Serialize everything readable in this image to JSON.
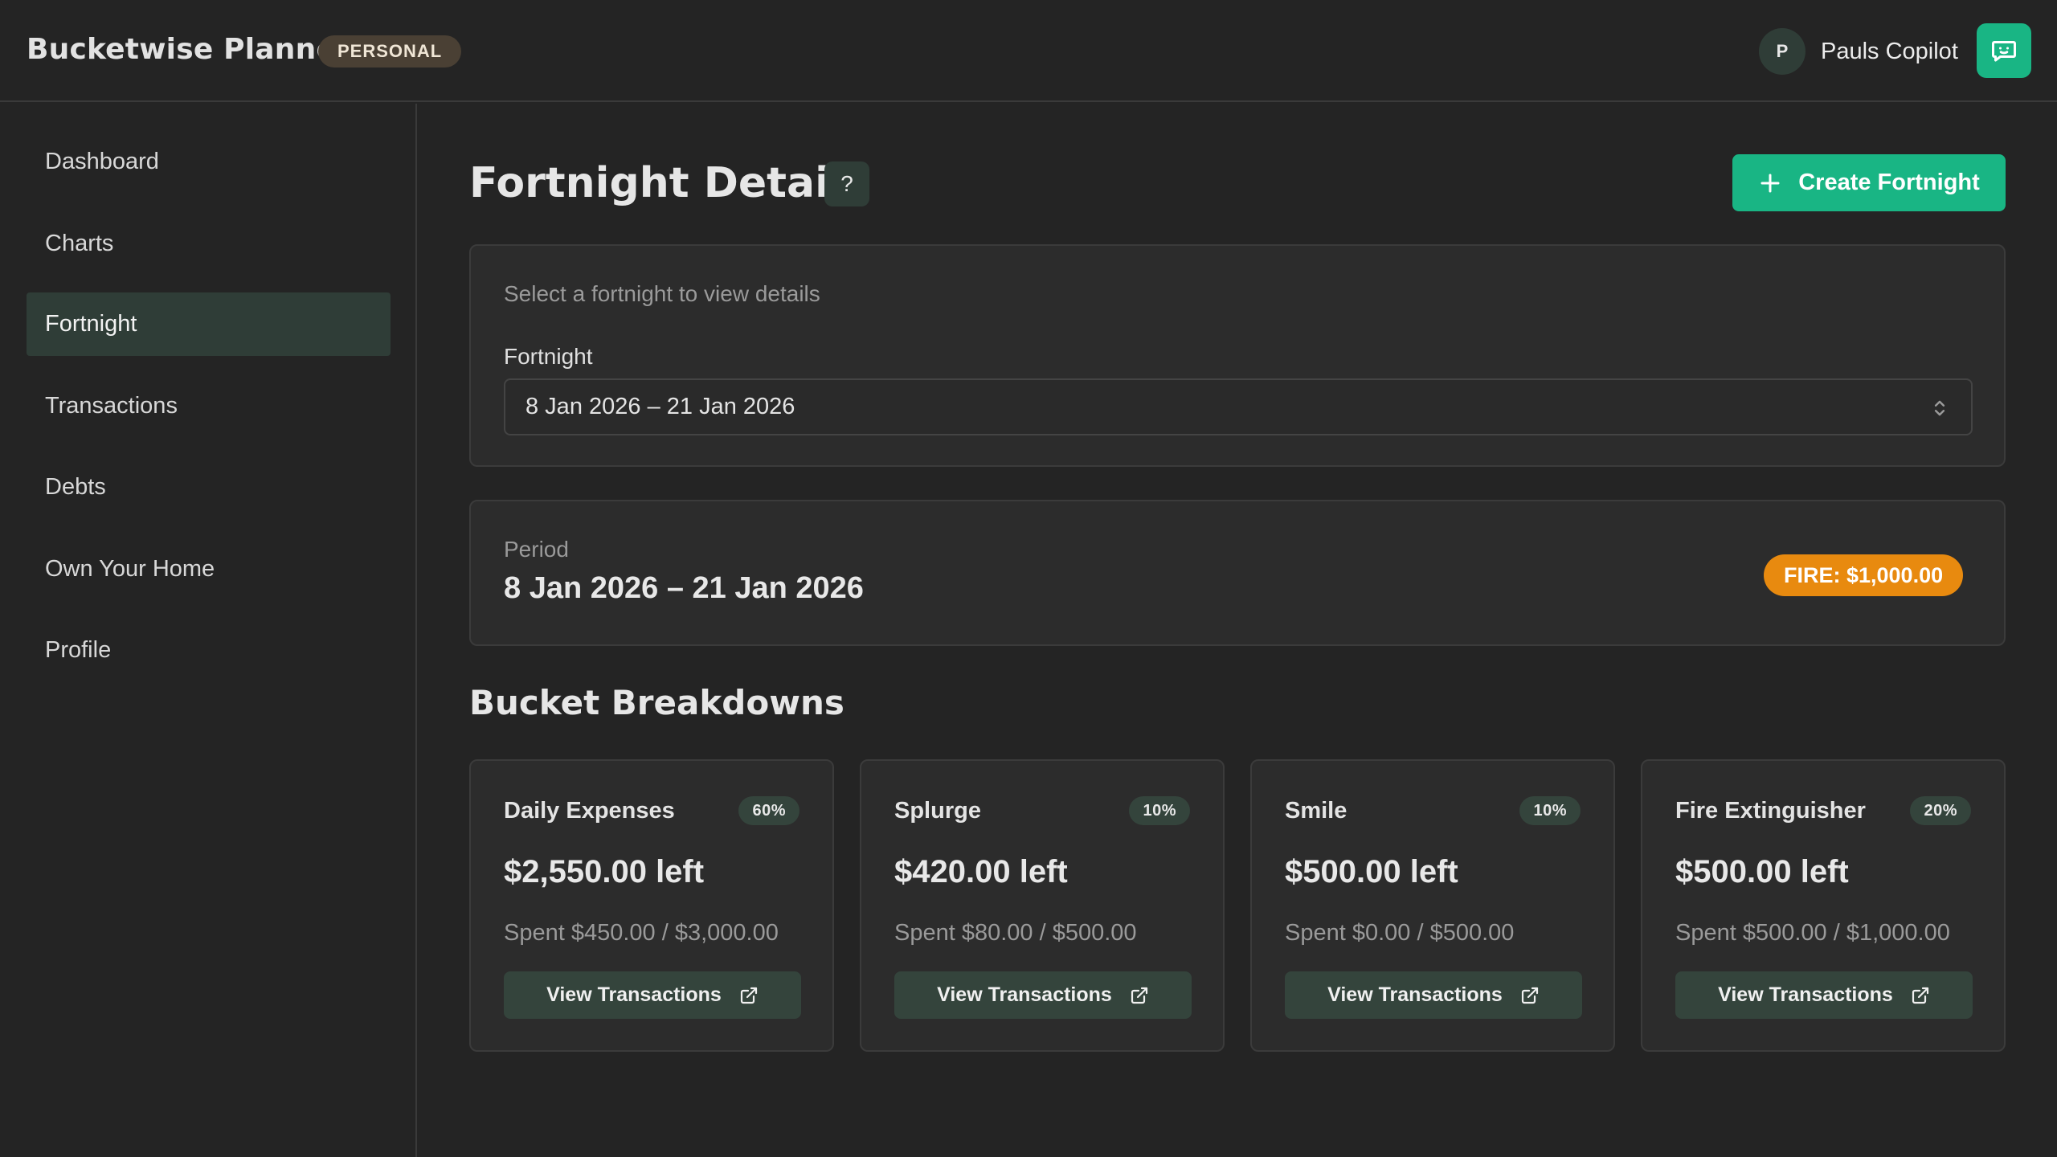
{
  "header": {
    "app_title": "Bucketwise Planner",
    "mode_badge": "PERSONAL",
    "user_initial": "P",
    "user_name": "Pauls Copilot"
  },
  "sidebar": {
    "items": [
      {
        "label": "Dashboard",
        "active": false
      },
      {
        "label": "Charts",
        "active": false
      },
      {
        "label": "Fortnight",
        "active": true
      },
      {
        "label": "Transactions",
        "active": false
      },
      {
        "label": "Debts",
        "active": false
      },
      {
        "label": "Own Your Home",
        "active": false
      },
      {
        "label": "Profile",
        "active": false
      }
    ]
  },
  "main": {
    "page_title": "Fortnight Details",
    "help_label": "?",
    "create_button_label": "Create Fortnight",
    "selector": {
      "hint": "Select a fortnight to view details",
      "field_label": "Fortnight",
      "selected_value": "8 Jan 2026 – 21 Jan 2026"
    },
    "period": {
      "label": "Period",
      "value": "8 Jan 2026 – 21 Jan 2026",
      "fire_badge": "FIRE: $1,000.00"
    },
    "section_title": "Bucket Breakdowns",
    "buckets": [
      {
        "name": "Daily Expenses",
        "pct": "60%",
        "left": "$2,550.00 left",
        "spent": "Spent $450.00 / $3,000.00",
        "button": "View Transactions"
      },
      {
        "name": "Splurge",
        "pct": "10%",
        "left": "$420.00 left",
        "spent": "Spent $80.00 / $500.00",
        "button": "View Transactions"
      },
      {
        "name": "Smile",
        "pct": "10%",
        "left": "$500.00 left",
        "spent": "Spent $0.00 / $500.00",
        "button": "View Transactions"
      },
      {
        "name": "Fire Extinguisher",
        "pct": "20%",
        "left": "$500.00 left",
        "spent": "Spent $500.00 / $1,000.00",
        "button": "View Transactions"
      }
    ]
  },
  "colors": {
    "accent": "#19b584",
    "fire": "#e88a0f",
    "active_nav": "#2f3d37"
  },
  "icons": {
    "chat": "message-square-icon",
    "plus": "plus-icon",
    "select": "chevron-up-down-icon",
    "external": "external-link-icon"
  }
}
